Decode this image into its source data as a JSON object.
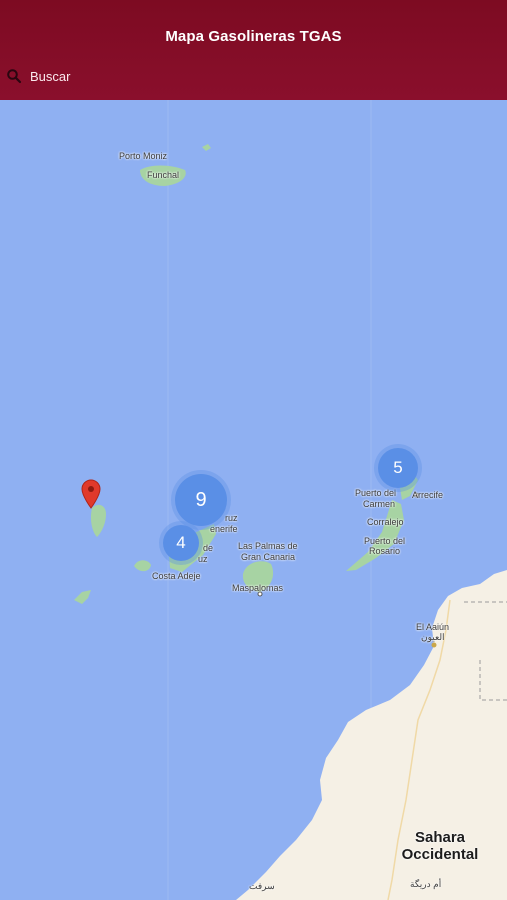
{
  "header": {
    "title": "Mapa Gasolineras TGAS"
  },
  "search": {
    "label": "Buscar",
    "icon": "search-icon"
  },
  "map": {
    "labels": {
      "porto_moniz": "Porto Moniz",
      "funchal": "Funchal",
      "puerto_del_carmen_1": "Puerto del",
      "puerto_del_carmen_2": "Carmen",
      "arrecife": "Arrecife",
      "corralejo": "Corralejo",
      "puerto_rosario_1": "Puerto del",
      "puerto_rosario_2": "Rosario",
      "santa_cruz_1": "ruz",
      "santa_cruz_2": "enerife",
      "cruz_partial": "uz",
      "de_partial": "de",
      "las_palmas_1": "Las Palmas de",
      "las_palmas_2": "Gran Canaria",
      "costa_adeje": "Costa Adeje",
      "maspalomas": "Maspalomas",
      "el_aaiun_1": "El Aaiún",
      "el_aaiun_2": "العيون",
      "sahara_1": "Sahara",
      "sahara_2": "Occidental",
      "sahara_ar": "أم دريگة",
      "bottom_ar": "سرفت"
    },
    "clusters": {
      "five": "5",
      "nine": "9",
      "four": "4"
    },
    "marker": "map-pin-icon",
    "colors": {
      "water": "#8fb0f2",
      "land": "#f5f0e5",
      "island_green": "#a7d3a3",
      "cluster": "#5a8fe6",
      "pin": "#e0392b",
      "appbar": "#7d0b22"
    }
  }
}
